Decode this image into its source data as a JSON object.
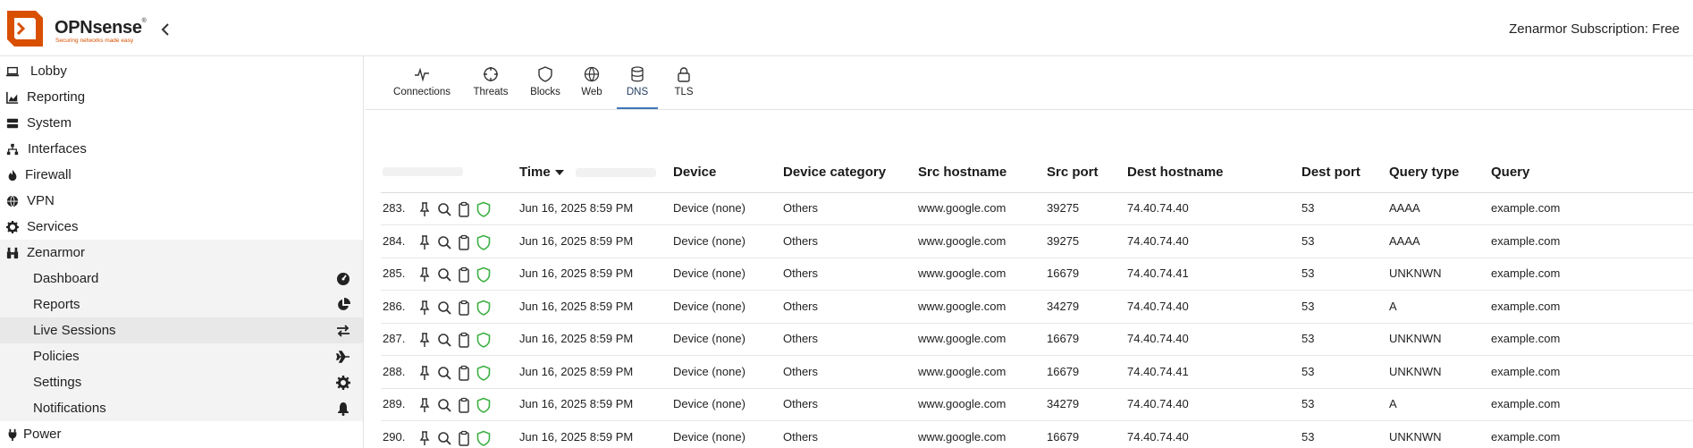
{
  "header": {
    "brand": "OPNsense",
    "trademark": "®",
    "tagline": "Securing networks made easy",
    "subscription": "Zenarmor Subscription: Free"
  },
  "sidebar": {
    "items": [
      {
        "label": "Lobby",
        "icon": "laptop-icon"
      },
      {
        "label": "Reporting",
        "icon": "area-chart-icon"
      },
      {
        "label": "System",
        "icon": "server-icon"
      },
      {
        "label": "Interfaces",
        "icon": "sitemap-icon"
      },
      {
        "label": "Firewall",
        "icon": "fire-icon"
      },
      {
        "label": "VPN",
        "icon": "globe-icon"
      },
      {
        "label": "Services",
        "icon": "gear-icon"
      },
      {
        "label": "Zenarmor",
        "icon": "binoculars-icon"
      }
    ],
    "subitems": [
      {
        "label": "Dashboard",
        "icon": "dashboard-icon"
      },
      {
        "label": "Reports",
        "icon": "pie-chart-icon"
      },
      {
        "label": "Live Sessions",
        "icon": "exchange-icon"
      },
      {
        "label": "Policies",
        "icon": "plane-icon"
      },
      {
        "label": "Settings",
        "icon": "gear-icon"
      },
      {
        "label": "Notifications",
        "icon": "bell-icon"
      }
    ],
    "power": {
      "label": "Power",
      "icon": "plug-icon"
    }
  },
  "tabs": [
    {
      "label": "Connections",
      "icon": "pulse-icon"
    },
    {
      "label": "Threats",
      "icon": "crosshair-icon"
    },
    {
      "label": "Blocks",
      "icon": "shield-icon"
    },
    {
      "label": "Web",
      "icon": "globe-icon"
    },
    {
      "label": "DNS",
      "icon": "database-icon",
      "active": true
    },
    {
      "label": "TLS",
      "icon": "lock-icon"
    }
  ],
  "table": {
    "columns": [
      "Time",
      "Device",
      "Device category",
      "Src hostname",
      "Src port",
      "Dest hostname",
      "Dest port",
      "Query type",
      "Query"
    ],
    "rows": [
      {
        "num": "283.",
        "time": "Jun 16, 2025 8:59 PM",
        "device": "Device (none)",
        "category": "Others",
        "src_host": "www.google.com",
        "src_port": "39275",
        "dest_host": "74.40.74.40",
        "dest_port": "53",
        "qtype": "AAAA",
        "query": "example.com"
      },
      {
        "num": "284.",
        "time": "Jun 16, 2025 8:59 PM",
        "device": "Device (none)",
        "category": "Others",
        "src_host": "www.google.com",
        "src_port": "39275",
        "dest_host": "74.40.74.40",
        "dest_port": "53",
        "qtype": "AAAA",
        "query": "example.com"
      },
      {
        "num": "285.",
        "time": "Jun 16, 2025 8:59 PM",
        "device": "Device (none)",
        "category": "Others",
        "src_host": "www.google.com",
        "src_port": "16679",
        "dest_host": "74.40.74.41",
        "dest_port": "53",
        "qtype": "UNKNWN",
        "query": "example.com"
      },
      {
        "num": "286.",
        "time": "Jun 16, 2025 8:59 PM",
        "device": "Device (none)",
        "category": "Others",
        "src_host": "www.google.com",
        "src_port": "34279",
        "dest_host": "74.40.74.40",
        "dest_port": "53",
        "qtype": "A",
        "query": "example.com"
      },
      {
        "num": "287.",
        "time": "Jun 16, 2025 8:59 PM",
        "device": "Device (none)",
        "category": "Others",
        "src_host": "www.google.com",
        "src_port": "16679",
        "dest_host": "74.40.74.40",
        "dest_port": "53",
        "qtype": "UNKNWN",
        "query": "example.com"
      },
      {
        "num": "288.",
        "time": "Jun 16, 2025 8:59 PM",
        "device": "Device (none)",
        "category": "Others",
        "src_host": "www.google.com",
        "src_port": "16679",
        "dest_host": "74.40.74.41",
        "dest_port": "53",
        "qtype": "UNKNWN",
        "query": "example.com"
      },
      {
        "num": "289.",
        "time": "Jun 16, 2025 8:59 PM",
        "device": "Device (none)",
        "category": "Others",
        "src_host": "www.google.com",
        "src_port": "34279",
        "dest_host": "74.40.74.40",
        "dest_port": "53",
        "qtype": "A",
        "query": "example.com"
      },
      {
        "num": "290.",
        "time": "Jun 16, 2025 8:59 PM",
        "device": "Device (none)",
        "category": "Others",
        "src_host": "www.google.com",
        "src_port": "16679",
        "dest_host": "74.40.74.40",
        "dest_port": "53",
        "qtype": "UNKNWN",
        "query": "example.com"
      }
    ]
  },
  "colors": {
    "brand_orange": "#d94f00",
    "tab_accent": "#3d78b8",
    "shield_green": "#3cb043"
  }
}
